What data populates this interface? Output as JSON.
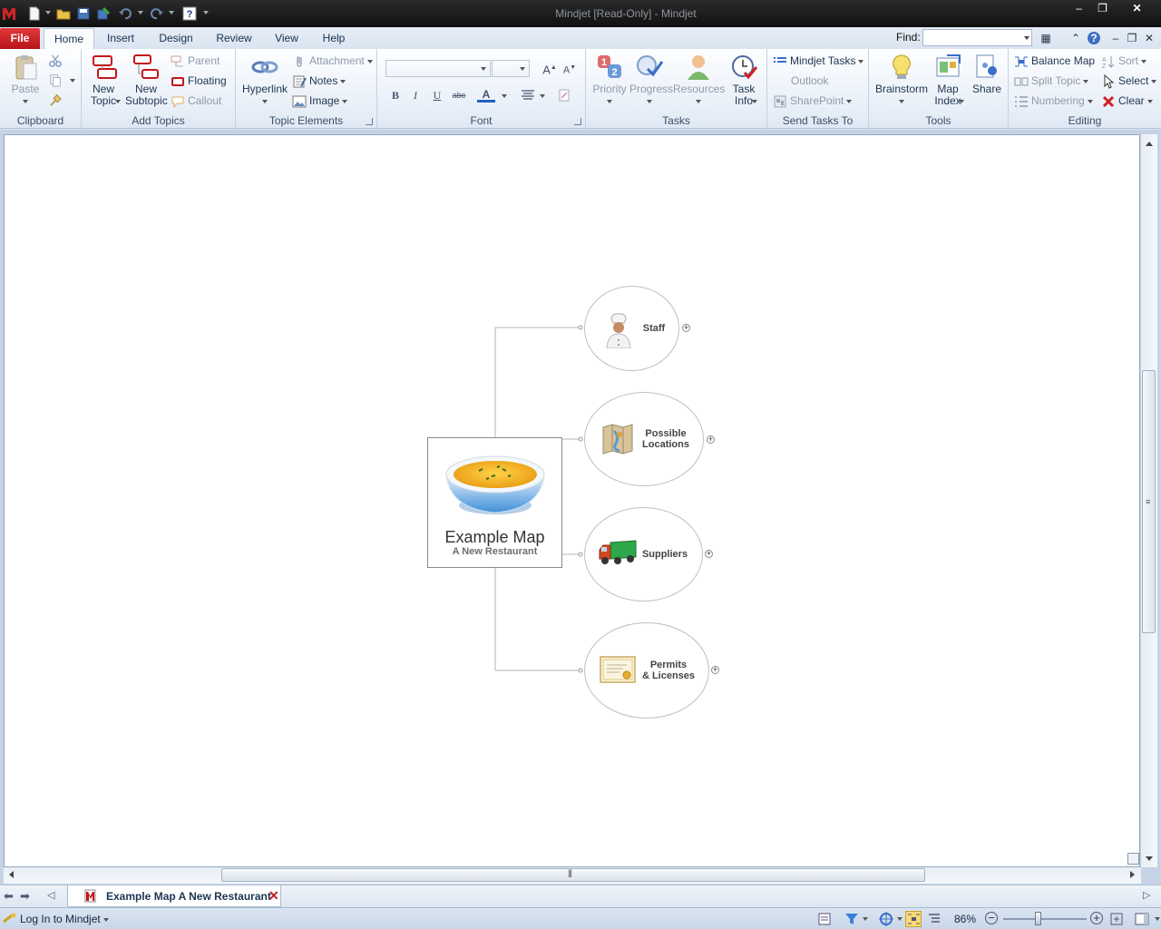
{
  "window": {
    "title": "Mindjet [Read-Only] - Mindjet"
  },
  "ribbon_tabs": {
    "file": "File",
    "home": "Home",
    "insert": "Insert",
    "design": "Design",
    "review": "Review",
    "view": "View",
    "help": "Help"
  },
  "find": {
    "label": "Find:",
    "value": ""
  },
  "groups": {
    "clipboard": {
      "label": "Clipboard",
      "paste": "Paste"
    },
    "add_topics": {
      "label": "Add Topics",
      "new_topic": "New Topic",
      "new_subtopic": "New Subtopic",
      "parent": "Parent",
      "floating": "Floating",
      "callout": "Callout"
    },
    "topic_elements": {
      "label": "Topic Elements",
      "hyperlink": "Hyperlink",
      "attachment": "Attachment",
      "notes": "Notes",
      "image": "Image"
    },
    "font": {
      "label": "Font",
      "bold": "B",
      "italic": "I",
      "underline": "U",
      "strike": "abc",
      "font_color": "A"
    },
    "tasks": {
      "label": "Tasks",
      "priority": "Priority",
      "progress": "Progress",
      "resources": "Resources",
      "task_info": "Task Info"
    },
    "send_tasks": {
      "label": "Send Tasks To",
      "mindjet_tasks": "Mindjet Tasks",
      "outlook": "Outlook",
      "sharepoint": "SharePoint"
    },
    "tools": {
      "label": "Tools",
      "brainstorm": "Brainstorm",
      "map_index": "Map Index",
      "share": "Share"
    },
    "editing": {
      "label": "Editing",
      "balance_map": "Balance Map",
      "sort": "Sort",
      "split_topic": "Split Topic",
      "select": "Select",
      "numbering": "Numbering",
      "clear": "Clear"
    }
  },
  "map": {
    "central": {
      "title": "Example Map",
      "subtitle": "A New Restaurant"
    },
    "subtopics": [
      {
        "label_1": "Staff",
        "label_2": ""
      },
      {
        "label_1": "Possible",
        "label_2": "Locations"
      },
      {
        "label_1": "Suppliers",
        "label_2": ""
      },
      {
        "label_1": "Permits",
        "label_2": "& Licenses"
      }
    ]
  },
  "document_tab": {
    "label": "Example Map A New Restaurant"
  },
  "status": {
    "login": "Log In to Mindjet",
    "zoom": "86%"
  },
  "colors": {
    "accent": "#c4161c",
    "ribbon_text": "#1f3550"
  }
}
